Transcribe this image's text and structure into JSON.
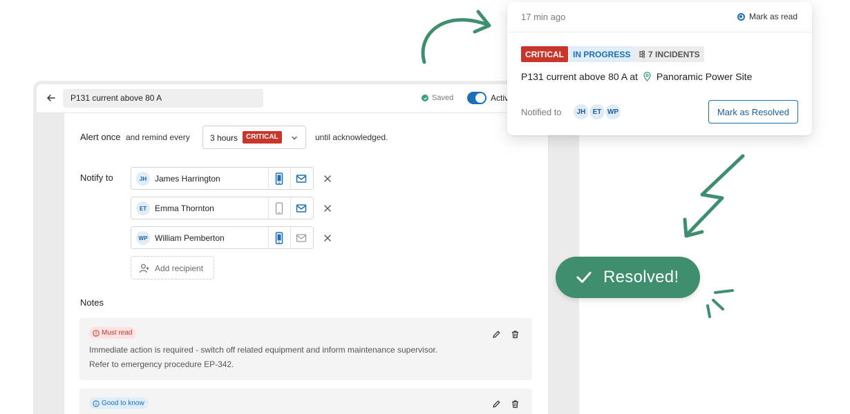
{
  "editor": {
    "title_value": "P131 current above 80 A",
    "saved_label": "Saved",
    "active_label": "Active",
    "alert_once_label": "Alert once",
    "remind_label": "and remind every",
    "interval_value": "3 hours",
    "interval_severity": "CRITICAL",
    "until_label": "until acknowledged.",
    "notify_label": "Notify to",
    "recipients": [
      {
        "initials": "JH",
        "name": "James Harrington",
        "phone_enabled": true,
        "email_enabled": true
      },
      {
        "initials": "ET",
        "name": "Emma Thornton",
        "phone_enabled": false,
        "email_enabled": true
      },
      {
        "initials": "WP",
        "name": "William Pemberton",
        "phone_enabled": true,
        "email_enabled": false
      }
    ],
    "add_recipient_label": "Add recipient",
    "notes_label": "Notes",
    "notes": [
      {
        "tag": "Must read",
        "tag_icon": "alert-circle-icon",
        "lines": [
          "Immediate action is required - switch off related equipment and inform maintenance supervisor.",
          "Refer to emergency procedure EP-342."
        ]
      },
      {
        "tag": "Good to know",
        "tag_icon": "info-circle-icon",
        "lines": []
      }
    ]
  },
  "notification": {
    "time_ago": "17 min ago",
    "mark_read_label": "Mark as read",
    "badges": {
      "severity": "CRITICAL",
      "status": "IN PROGRESS",
      "incidents": "7 INCIDENTS"
    },
    "message": "P131 current above 80 A at",
    "site": "Panoramic Power Site",
    "notified_label": "Notified to",
    "notified_initials": [
      "JH",
      "ET",
      "WP"
    ],
    "resolve_label": "Mark as Resolved"
  },
  "resolved_toast": {
    "label": "Resolved!"
  },
  "colors": {
    "critical": "#c8352b",
    "primary": "#1b6fb6",
    "success": "#3f8f6e",
    "muted": "#9a9a9a"
  }
}
